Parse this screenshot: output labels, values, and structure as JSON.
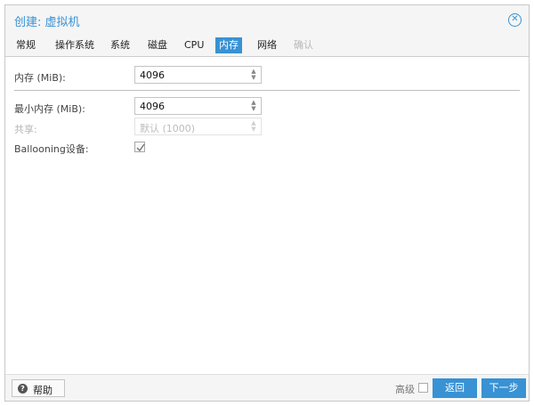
{
  "window": {
    "title": "创建: 虚拟机"
  },
  "tabs": [
    {
      "label": "常规"
    },
    {
      "label": "操作系统"
    },
    {
      "label": "系统"
    },
    {
      "label": "磁盘"
    },
    {
      "label": "CPU"
    },
    {
      "label": "内存"
    },
    {
      "label": "网络"
    },
    {
      "label": "确认"
    }
  ],
  "active_tab": "内存",
  "form": {
    "memory": {
      "label": "内存 (MiB):",
      "value": "4096"
    },
    "min_memory": {
      "label": "最小内存 (MiB):",
      "value": "4096"
    },
    "shares": {
      "label": "共享:",
      "placeholder": "默认 (1000)"
    },
    "ballooning": {
      "label": "Ballooning设备:",
      "checked": true
    }
  },
  "footer": {
    "help_label": "帮助",
    "advanced_label": "高级",
    "back_label": "返回",
    "next_label": "下一步"
  },
  "colors": {
    "accent": "#3892d4"
  },
  "icons": {
    "close": "close-circle-icon",
    "help": "question-circle-icon",
    "spinner": "spinner-arrows-icon",
    "check": "checkmark-icon"
  }
}
